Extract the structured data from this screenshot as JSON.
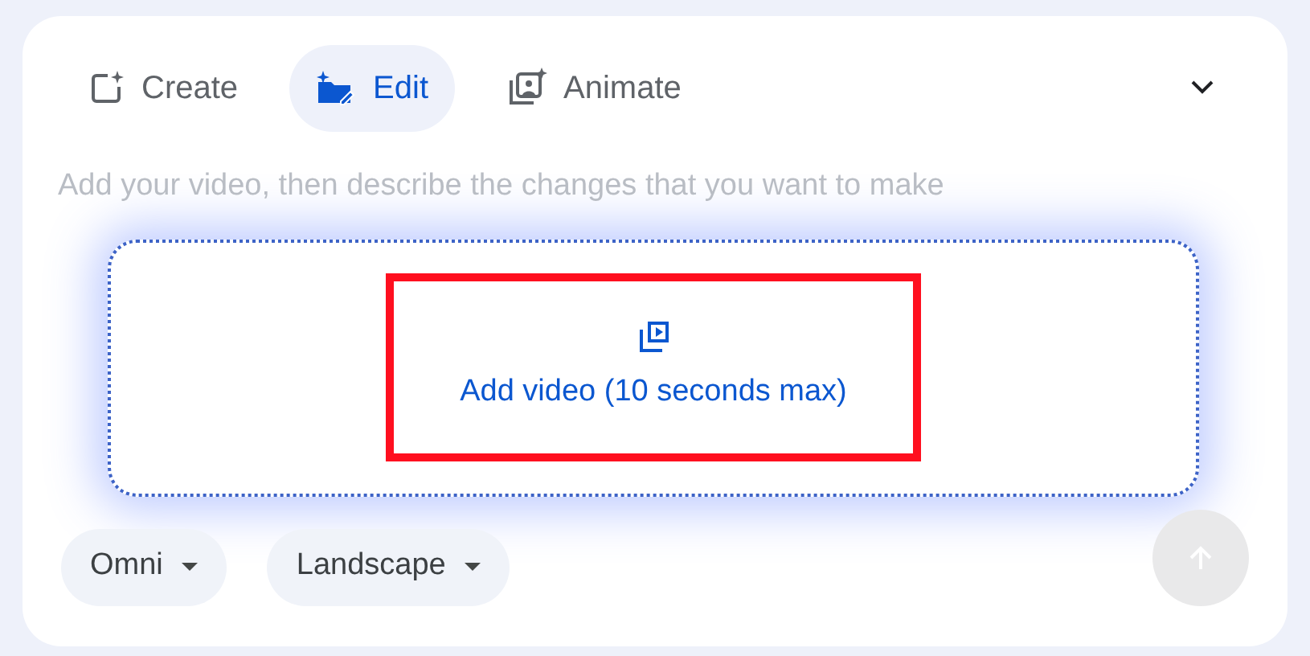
{
  "tabs": [
    {
      "label": "Create",
      "kind": "create",
      "selected": false
    },
    {
      "label": "Edit",
      "kind": "edit",
      "selected": true
    },
    {
      "label": "Animate",
      "kind": "animate",
      "selected": false
    }
  ],
  "prompt": {
    "placeholder": "Add your video, then describe the changes that you want to make"
  },
  "upload": {
    "label": "Add video (10 seconds max)"
  },
  "chips": [
    {
      "label": "Omni"
    },
    {
      "label": "Landscape"
    }
  ],
  "send_button": {
    "disabled": true
  }
}
